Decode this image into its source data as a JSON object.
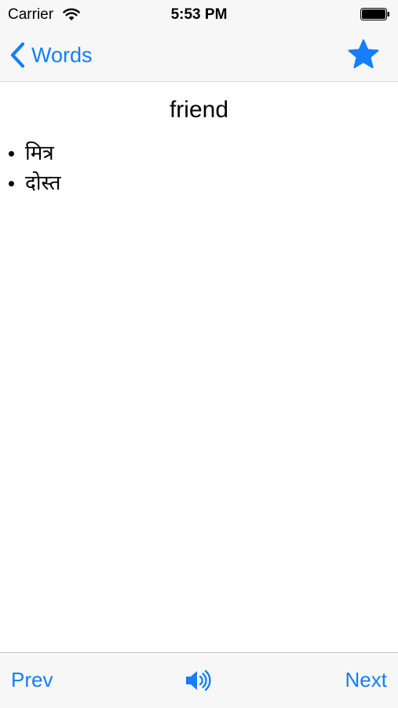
{
  "status_bar": {
    "carrier": "Carrier",
    "time": "5:53 PM"
  },
  "nav": {
    "back_label": "Words",
    "favorite_icon": "star-icon"
  },
  "word": {
    "title": "friend",
    "meanings": [
      "मित्र",
      "दोस्त"
    ]
  },
  "toolbar": {
    "prev_label": "Prev",
    "next_label": "Next",
    "speaker_icon": "speaker-icon"
  },
  "colors": {
    "accent": "#147efb",
    "bar_background": "#f7f7f7",
    "text": "#000000"
  }
}
